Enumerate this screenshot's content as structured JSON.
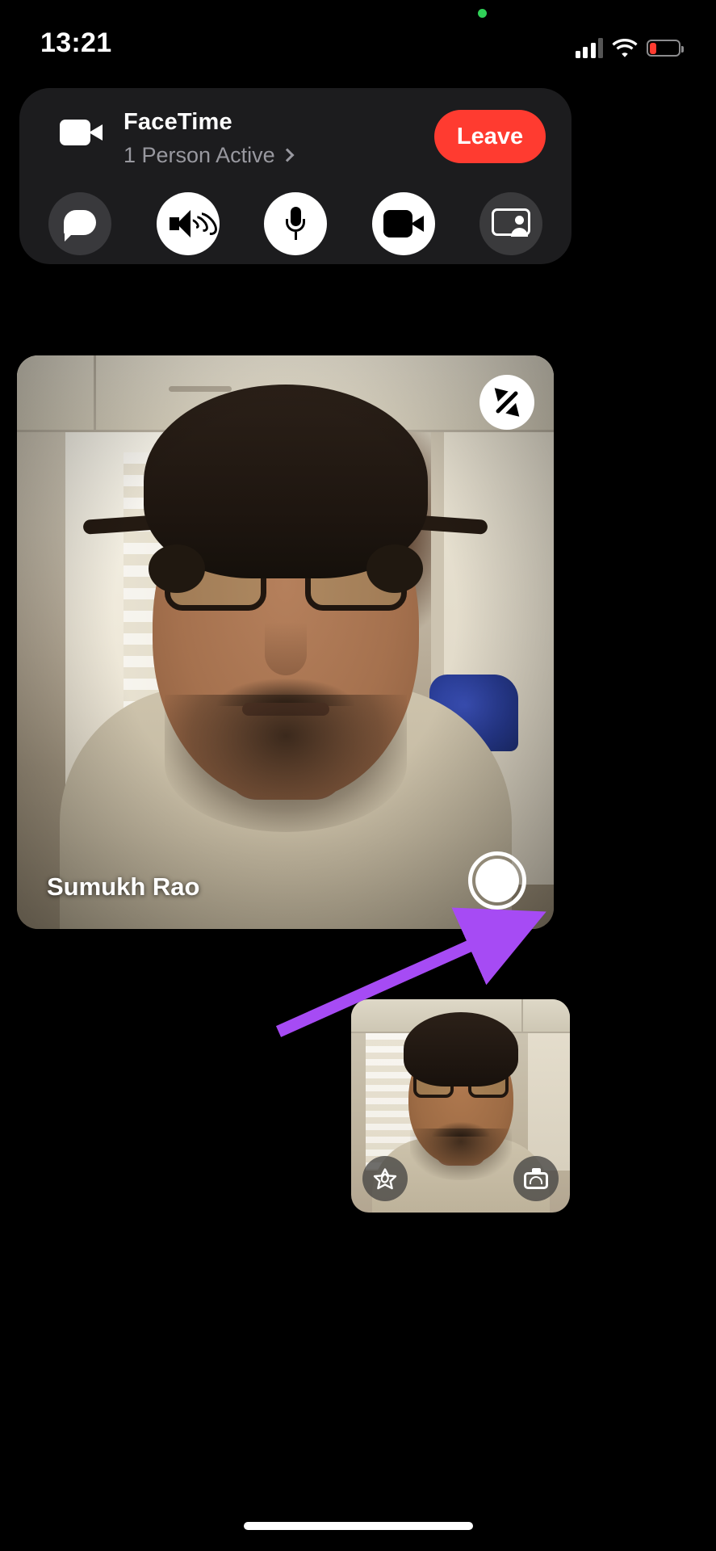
{
  "status_bar": {
    "time": "13:21",
    "privacy_indicator": "green-recording-dot",
    "cellular_icon": "signal-bars-icon",
    "wifi_icon": "wifi-icon",
    "battery_icon": "battery-low-icon",
    "battery_color": "#ff3b30"
  },
  "facetime_banner": {
    "app_icon": "video-camera-icon",
    "title": "FaceTime",
    "subtitle": "1 Person Active",
    "subtitle_chevron": "chevron-right-icon",
    "leave_label": "Leave",
    "leave_color": "#ff3b30",
    "controls": [
      {
        "name": "messages-button",
        "icon": "message-bubble-icon",
        "state": "inactive"
      },
      {
        "name": "speaker-button",
        "icon": "speaker-wave-icon",
        "state": "active"
      },
      {
        "name": "microphone-button",
        "icon": "microphone-icon",
        "state": "active"
      },
      {
        "name": "camera-button",
        "icon": "video-camera-icon",
        "state": "active"
      },
      {
        "name": "share-screen-button",
        "icon": "share-screen-icon",
        "state": "inactive"
      }
    ]
  },
  "remote_video": {
    "participant_name": "Sumukh Rao",
    "expand_icon": "expand-arrows-icon",
    "capture_button_icon": "live-photo-shutter-icon"
  },
  "self_video": {
    "effects_icon": "effects-star-icon",
    "flip_camera_icon": "flip-camera-icon"
  },
  "annotation": {
    "arrow_color": "#a64bf4",
    "points_to": "live-photo-shutter-button"
  },
  "home_indicator": "home-indicator-bar"
}
